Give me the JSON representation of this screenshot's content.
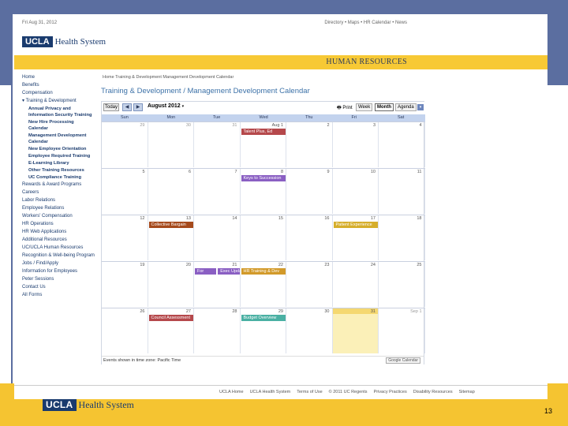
{
  "slide": {
    "logo_ucla": "UCLA",
    "logo_hs": "Health System",
    "page_number": "13"
  },
  "page": {
    "date_text": "Fri Aug 31, 2012",
    "top_links": "Directory • Maps • HR Calendar • News",
    "logo_ucla": "UCLA",
    "logo_hs": "Health System",
    "banner_title": "HUMAN RESOURCES",
    "breadcrumb": "Home    Training & Development    Management Development Calendar",
    "title": "Training & Development / Management Development Calendar"
  },
  "nav": {
    "items": [
      {
        "label": "Home"
      },
      {
        "label": "Benefits"
      },
      {
        "label": "Compensation"
      },
      {
        "label": "▾ Training & Development"
      }
    ],
    "sub_items": [
      {
        "label": "Annual Privacy and Information Security Training"
      },
      {
        "label": "New Hire Processing Calendar"
      },
      {
        "label": "Management Development Calendar"
      },
      {
        "label": "New Employee Orientation"
      },
      {
        "label": "Employee Required Training"
      },
      {
        "label": "E-Learning Library"
      },
      {
        "label": "Other Training Resources"
      },
      {
        "label": "UC Compliance Training"
      }
    ],
    "more_items": [
      {
        "label": "Rewards & Award Programs"
      },
      {
        "label": "Careers"
      },
      {
        "label": "Labor Relations"
      },
      {
        "label": "Employee Relations"
      },
      {
        "label": "Workers' Compensation"
      },
      {
        "label": "HR Operations"
      },
      {
        "label": "HR Web Applications"
      },
      {
        "label": "Additional Resources"
      },
      {
        "label": "UC/UCLA Human Resources"
      },
      {
        "label": "Recognition & Well-being Programs"
      },
      {
        "label": "Jobs / Find/Apply"
      },
      {
        "label": "Information for Employees"
      },
      {
        "label": "Peter Sessions"
      },
      {
        "label": "Contact Us"
      },
      {
        "label": "All Forms"
      }
    ]
  },
  "calendar": {
    "today_label": "Today",
    "prev_label": "◀",
    "next_label": "▶",
    "month_label": "August 2012",
    "month_caret": "▾",
    "print_label": "🖶 Print",
    "view_week": "Week",
    "view_month": "Month",
    "view_agenda": "Agenda",
    "dropdown_label": "▾",
    "days_of_week": [
      "Sun",
      "Mon",
      "Tue",
      "Wed",
      "Thu",
      "Fri",
      "Sat"
    ],
    "weeks": [
      [
        "29",
        "30",
        "31",
        "Aug 1",
        "2",
        "3",
        "4"
      ],
      [
        "5",
        "6",
        "7",
        "8",
        "9",
        "10",
        "11"
      ],
      [
        "12",
        "13",
        "14",
        "15",
        "16",
        "17",
        "18"
      ],
      [
        "19",
        "20",
        "21",
        "22",
        "23",
        "24",
        "25"
      ],
      [
        "26",
        "27",
        "28",
        "29",
        "30",
        "31",
        "Sep 1"
      ]
    ],
    "events": [
      {
        "label": "Talent Plus, Ed",
        "week": 0,
        "day": 3,
        "color": "#b5484b"
      },
      {
        "label": "Keys to Succession",
        "week": 1,
        "day": 3,
        "color": "#8a5fc3"
      },
      {
        "label": "Collective Bargain",
        "week": 2,
        "day": 1,
        "color": "#a64a1c"
      },
      {
        "label": "Patient Experience",
        "week": 2,
        "day": 5,
        "color": "#d6ae2b"
      },
      {
        "label": "For",
        "week": 3,
        "day": 2,
        "color": "#8a5fc3"
      },
      {
        "label": "Exec Update",
        "week": 3,
        "day": 2.5,
        "color": "#8a5fc3"
      },
      {
        "label": "HR Training & Dev",
        "week": 3,
        "day": 3,
        "color": "#d29a2a"
      },
      {
        "label": "Council Assessment",
        "week": 4,
        "day": 1,
        "color": "#b5484b"
      },
      {
        "label": "Budget Overview",
        "week": 4,
        "day": 3,
        "color": "#4ab0a3"
      }
    ],
    "timezone_note": "Events shown in time zone: Pacific Time",
    "gcal_label": "Google Calendar"
  },
  "footer": {
    "links": [
      "UCLA Home",
      "UCLA Health System",
      "Terms of Use",
      "© 2011 UC Regents",
      "Privacy Practices",
      "Disability Resources",
      "Sitemap"
    ]
  }
}
